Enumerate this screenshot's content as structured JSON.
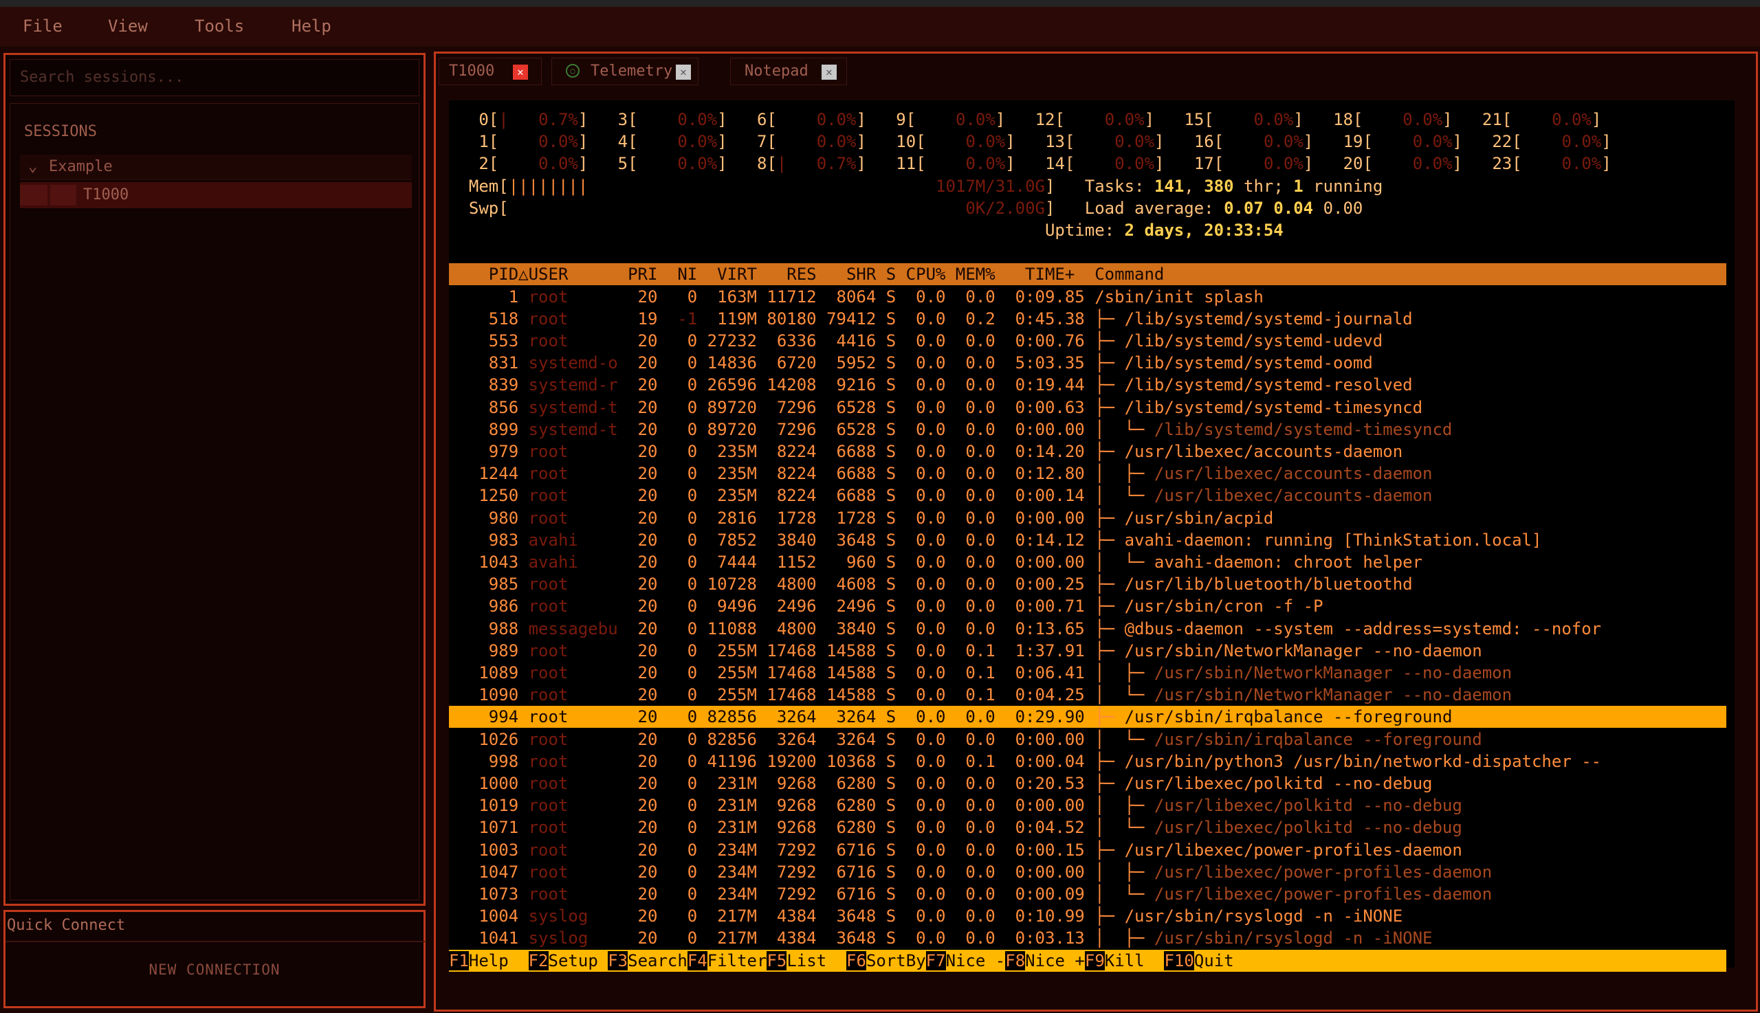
{
  "menu": [
    "File",
    "View",
    "Tools",
    "Help"
  ],
  "sidebar": {
    "search_placeholder": "Search sessions...",
    "sessions_title": "SESSIONS",
    "folder": "Example",
    "session": "T1000"
  },
  "quick_connect": {
    "title": "Quick Connect",
    "new_connection": "NEW CONNECTION"
  },
  "tabs": [
    {
      "label": "T1000",
      "active": true
    },
    {
      "label": "Telemetry",
      "active": false
    },
    {
      "label": "Notepad",
      "active": false
    }
  ],
  "colors": {
    "accent": "#c0391b",
    "header_bar": "#d2711a",
    "selected_row": "#ffa500",
    "terminal_text": "#ff8c3c",
    "close_active": "#e8362c"
  },
  "htop": {
    "cpus": [
      {
        "id": "0",
        "pct": "0.7%"
      },
      {
        "id": "1",
        "pct": "0.0%"
      },
      {
        "id": "2",
        "pct": "0.0%"
      },
      {
        "id": "3",
        "pct": "0.0%"
      },
      {
        "id": "4",
        "pct": "0.0%"
      },
      {
        "id": "5",
        "pct": "0.0%"
      },
      {
        "id": "6",
        "pct": "0.0%"
      },
      {
        "id": "7",
        "pct": "0.0%"
      },
      {
        "id": "8",
        "pct": "0.7%"
      },
      {
        "id": "9",
        "pct": "0.0%"
      },
      {
        "id": "10",
        "pct": "0.0%"
      },
      {
        "id": "11",
        "pct": "0.0%"
      },
      {
        "id": "12",
        "pct": "0.0%"
      },
      {
        "id": "13",
        "pct": "0.0%"
      },
      {
        "id": "14",
        "pct": "0.0%"
      },
      {
        "id": "15",
        "pct": "0.0%"
      },
      {
        "id": "16",
        "pct": "0.0%"
      },
      {
        "id": "17",
        "pct": "0.0%"
      },
      {
        "id": "18",
        "pct": "0.0%"
      },
      {
        "id": "19",
        "pct": "0.0%"
      },
      {
        "id": "20",
        "pct": "0.0%"
      },
      {
        "id": "21",
        "pct": "0.0%"
      },
      {
        "id": "22",
        "pct": "0.0%"
      },
      {
        "id": "23",
        "pct": "0.0%"
      }
    ],
    "mem_label": "Mem",
    "mem_bar": "||||||||",
    "mem_value": "1017M/31.0G",
    "swp_label": "Swp",
    "swp_value": "0K/2.00G",
    "tasks": "141",
    "threads": "380",
    "running": "1",
    "load1": "0.07",
    "load5": "0.04",
    "load15": "0.00",
    "uptime": "2 days, 20:33:54",
    "columns": [
      "PID",
      "USER",
      "PRI",
      "NI",
      "VIRT",
      "RES",
      "SHR",
      "S",
      "CPU%",
      "MEM%",
      "TIME+",
      "Command"
    ],
    "rows": [
      {
        "pid": "1",
        "user": "root",
        "pri": "20",
        "ni": "0",
        "virt": "163M",
        "res": "11712",
        "shr": "8064",
        "s": "S",
        "cpu": "0.0",
        "mem": "0.0",
        "time": "0:09.85",
        "tree": "",
        "cmd": "/sbin/init splash",
        "thread": false
      },
      {
        "pid": "518",
        "user": "root",
        "pri": "19",
        "ni": "-1",
        "virt": "119M",
        "res": "80180",
        "shr": "79412",
        "s": "S",
        "cpu": "0.0",
        "mem": "0.2",
        "time": "0:45.38",
        "tree": "├─ ",
        "cmd": "/lib/systemd/systemd-journald",
        "thread": false
      },
      {
        "pid": "553",
        "user": "root",
        "pri": "20",
        "ni": "0",
        "virt": "27232",
        "res": "6336",
        "shr": "4416",
        "s": "S",
        "cpu": "0.0",
        "mem": "0.0",
        "time": "0:00.76",
        "tree": "├─ ",
        "cmd": "/lib/systemd/systemd-udevd",
        "thread": false
      },
      {
        "pid": "831",
        "user": "systemd-o",
        "pri": "20",
        "ni": "0",
        "virt": "14836",
        "res": "6720",
        "shr": "5952",
        "s": "S",
        "cpu": "0.0",
        "mem": "0.0",
        "time": "5:03.35",
        "tree": "├─ ",
        "cmd": "/lib/systemd/systemd-oomd",
        "thread": false
      },
      {
        "pid": "839",
        "user": "systemd-r",
        "pri": "20",
        "ni": "0",
        "virt": "26596",
        "res": "14208",
        "shr": "9216",
        "s": "S",
        "cpu": "0.0",
        "mem": "0.0",
        "time": "0:19.44",
        "tree": "├─ ",
        "cmd": "/lib/systemd/systemd-resolved",
        "thread": false
      },
      {
        "pid": "856",
        "user": "systemd-t",
        "pri": "20",
        "ni": "0",
        "virt": "89720",
        "res": "7296",
        "shr": "6528",
        "s": "S",
        "cpu": "0.0",
        "mem": "0.0",
        "time": "0:00.63",
        "tree": "├─ ",
        "cmd": "/lib/systemd/systemd-timesyncd",
        "thread": false
      },
      {
        "pid": "899",
        "user": "systemd-t",
        "pri": "20",
        "ni": "0",
        "virt": "89720",
        "res": "7296",
        "shr": "6528",
        "s": "S",
        "cpu": "0.0",
        "mem": "0.0",
        "time": "0:00.00",
        "tree": "│  └─ ",
        "cmd": "/lib/systemd/systemd-timesyncd",
        "thread": true
      },
      {
        "pid": "979",
        "user": "root",
        "pri": "20",
        "ni": "0",
        "virt": "235M",
        "res": "8224",
        "shr": "6688",
        "s": "S",
        "cpu": "0.0",
        "mem": "0.0",
        "time": "0:14.20",
        "tree": "├─ ",
        "cmd": "/usr/libexec/accounts-daemon",
        "thread": false
      },
      {
        "pid": "1244",
        "user": "root",
        "pri": "20",
        "ni": "0",
        "virt": "235M",
        "res": "8224",
        "shr": "6688",
        "s": "S",
        "cpu": "0.0",
        "mem": "0.0",
        "time": "0:12.80",
        "tree": "│  ├─ ",
        "cmd": "/usr/libexec/accounts-daemon",
        "thread": true
      },
      {
        "pid": "1250",
        "user": "root",
        "pri": "20",
        "ni": "0",
        "virt": "235M",
        "res": "8224",
        "shr": "6688",
        "s": "S",
        "cpu": "0.0",
        "mem": "0.0",
        "time": "0:00.14",
        "tree": "│  └─ ",
        "cmd": "/usr/libexec/accounts-daemon",
        "thread": true
      },
      {
        "pid": "980",
        "user": "root",
        "pri": "20",
        "ni": "0",
        "virt": "2816",
        "res": "1728",
        "shr": "1728",
        "s": "S",
        "cpu": "0.0",
        "mem": "0.0",
        "time": "0:00.00",
        "tree": "├─ ",
        "cmd": "/usr/sbin/acpid",
        "thread": false
      },
      {
        "pid": "983",
        "user": "avahi",
        "pri": "20",
        "ni": "0",
        "virt": "7852",
        "res": "3840",
        "shr": "3648",
        "s": "S",
        "cpu": "0.0",
        "mem": "0.0",
        "time": "0:14.12",
        "tree": "├─ ",
        "cmd": "avahi-daemon: running [ThinkStation.local]",
        "thread": false
      },
      {
        "pid": "1043",
        "user": "avahi",
        "pri": "20",
        "ni": "0",
        "virt": "7444",
        "res": "1152",
        "shr": "960",
        "s": "S",
        "cpu": "0.0",
        "mem": "0.0",
        "time": "0:00.00",
        "tree": "│  └─ ",
        "cmd": "avahi-daemon: chroot helper",
        "thread": false
      },
      {
        "pid": "985",
        "user": "root",
        "pri": "20",
        "ni": "0",
        "virt": "10728",
        "res": "4800",
        "shr": "4608",
        "s": "S",
        "cpu": "0.0",
        "mem": "0.0",
        "time": "0:00.25",
        "tree": "├─ ",
        "cmd": "/usr/lib/bluetooth/bluetoothd",
        "thread": false
      },
      {
        "pid": "986",
        "user": "root",
        "pri": "20",
        "ni": "0",
        "virt": "9496",
        "res": "2496",
        "shr": "2496",
        "s": "S",
        "cpu": "0.0",
        "mem": "0.0",
        "time": "0:00.71",
        "tree": "├─ ",
        "cmd": "/usr/sbin/cron -f -P",
        "thread": false
      },
      {
        "pid": "988",
        "user": "messagebu",
        "pri": "20",
        "ni": "0",
        "virt": "11088",
        "res": "4800",
        "shr": "3840",
        "s": "S",
        "cpu": "0.0",
        "mem": "0.0",
        "time": "0:13.65",
        "tree": "├─ ",
        "cmd": "@dbus-daemon --system --address=systemd: --nofor",
        "thread": false
      },
      {
        "pid": "989",
        "user": "root",
        "pri": "20",
        "ni": "0",
        "virt": "255M",
        "res": "17468",
        "shr": "14588",
        "s": "S",
        "cpu": "0.0",
        "mem": "0.1",
        "time": "1:37.91",
        "tree": "├─ ",
        "cmd": "/usr/sbin/NetworkManager --no-daemon",
        "thread": false
      },
      {
        "pid": "1089",
        "user": "root",
        "pri": "20",
        "ni": "0",
        "virt": "255M",
        "res": "17468",
        "shr": "14588",
        "s": "S",
        "cpu": "0.0",
        "mem": "0.1",
        "time": "0:06.41",
        "tree": "│  ├─ ",
        "cmd": "/usr/sbin/NetworkManager --no-daemon",
        "thread": true
      },
      {
        "pid": "1090",
        "user": "root",
        "pri": "20",
        "ni": "0",
        "virt": "255M",
        "res": "17468",
        "shr": "14588",
        "s": "S",
        "cpu": "0.0",
        "mem": "0.1",
        "time": "0:04.25",
        "tree": "│  └─ ",
        "cmd": "/usr/sbin/NetworkManager --no-daemon",
        "thread": true
      },
      {
        "pid": "994",
        "user": "root",
        "pri": "20",
        "ni": "0",
        "virt": "82856",
        "res": "3264",
        "shr": "3264",
        "s": "S",
        "cpu": "0.0",
        "mem": "0.0",
        "time": "0:29.90",
        "tree": "├─ ",
        "cmd": "/usr/sbin/irqbalance --foreground",
        "thread": false,
        "selected": true
      },
      {
        "pid": "1026",
        "user": "root",
        "pri": "20",
        "ni": "0",
        "virt": "82856",
        "res": "3264",
        "shr": "3264",
        "s": "S",
        "cpu": "0.0",
        "mem": "0.0",
        "time": "0:00.00",
        "tree": "│  └─ ",
        "cmd": "/usr/sbin/irqbalance --foreground",
        "thread": true
      },
      {
        "pid": "998",
        "user": "root",
        "pri": "20",
        "ni": "0",
        "virt": "41196",
        "res": "19200",
        "shr": "10368",
        "s": "S",
        "cpu": "0.0",
        "mem": "0.1",
        "time": "0:00.04",
        "tree": "├─ ",
        "cmd": "/usr/bin/python3 /usr/bin/networkd-dispatcher --",
        "thread": false
      },
      {
        "pid": "1000",
        "user": "root",
        "pri": "20",
        "ni": "0",
        "virt": "231M",
        "res": "9268",
        "shr": "6280",
        "s": "S",
        "cpu": "0.0",
        "mem": "0.0",
        "time": "0:20.53",
        "tree": "├─ ",
        "cmd": "/usr/libexec/polkitd --no-debug",
        "thread": false
      },
      {
        "pid": "1019",
        "user": "root",
        "pri": "20",
        "ni": "0",
        "virt": "231M",
        "res": "9268",
        "shr": "6280",
        "s": "S",
        "cpu": "0.0",
        "mem": "0.0",
        "time": "0:00.00",
        "tree": "│  ├─ ",
        "cmd": "/usr/libexec/polkitd --no-debug",
        "thread": true
      },
      {
        "pid": "1071",
        "user": "root",
        "pri": "20",
        "ni": "0",
        "virt": "231M",
        "res": "9268",
        "shr": "6280",
        "s": "S",
        "cpu": "0.0",
        "mem": "0.0",
        "time": "0:04.52",
        "tree": "│  └─ ",
        "cmd": "/usr/libexec/polkitd --no-debug",
        "thread": true
      },
      {
        "pid": "1003",
        "user": "root",
        "pri": "20",
        "ni": "0",
        "virt": "234M",
        "res": "7292",
        "shr": "6716",
        "s": "S",
        "cpu": "0.0",
        "mem": "0.0",
        "time": "0:00.15",
        "tree": "├─ ",
        "cmd": "/usr/libexec/power-profiles-daemon",
        "thread": false
      },
      {
        "pid": "1047",
        "user": "root",
        "pri": "20",
        "ni": "0",
        "virt": "234M",
        "res": "7292",
        "shr": "6716",
        "s": "S",
        "cpu": "0.0",
        "mem": "0.0",
        "time": "0:00.00",
        "tree": "│  ├─ ",
        "cmd": "/usr/libexec/power-profiles-daemon",
        "thread": true
      },
      {
        "pid": "1073",
        "user": "root",
        "pri": "20",
        "ni": "0",
        "virt": "234M",
        "res": "7292",
        "shr": "6716",
        "s": "S",
        "cpu": "0.0",
        "mem": "0.0",
        "time": "0:00.09",
        "tree": "│  └─ ",
        "cmd": "/usr/libexec/power-profiles-daemon",
        "thread": true
      },
      {
        "pid": "1004",
        "user": "syslog",
        "pri": "20",
        "ni": "0",
        "virt": "217M",
        "res": "4384",
        "shr": "3648",
        "s": "S",
        "cpu": "0.0",
        "mem": "0.0",
        "time": "0:10.99",
        "tree": "├─ ",
        "cmd": "/usr/sbin/rsyslogd -n -iNONE",
        "thread": false
      },
      {
        "pid": "1041",
        "user": "syslog",
        "pri": "20",
        "ni": "0",
        "virt": "217M",
        "res": "4384",
        "shr": "3648",
        "s": "S",
        "cpu": "0.0",
        "mem": "0.0",
        "time": "0:03.13",
        "tree": "│  ├─ ",
        "cmd": "/usr/sbin/rsyslogd -n -iNONE",
        "thread": true
      }
    ],
    "function_keys": [
      {
        "key": "F1",
        "label": "Help  "
      },
      {
        "key": "F2",
        "label": "Setup "
      },
      {
        "key": "F3",
        "label": "Search"
      },
      {
        "key": "F4",
        "label": "Filter"
      },
      {
        "key": "F5",
        "label": "List  "
      },
      {
        "key": "F6",
        "label": "SortBy"
      },
      {
        "key": "F7",
        "label": "Nice -"
      },
      {
        "key": "F8",
        "label": "Nice +"
      },
      {
        "key": "F9",
        "label": "Kill  "
      },
      {
        "key": "F10",
        "label": "Quit"
      }
    ]
  }
}
